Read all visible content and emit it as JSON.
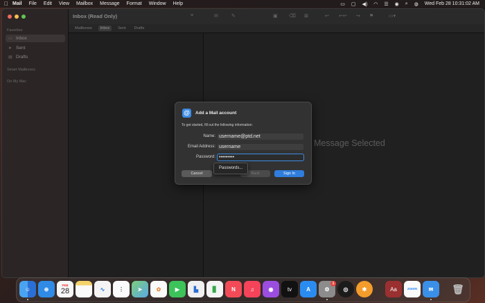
{
  "menubar": {
    "app_name": "Mail",
    "items": [
      "File",
      "Edit",
      "View",
      "Mailbox",
      "Message",
      "Format",
      "Window",
      "Help"
    ],
    "clock": "Wed Feb 28  10:31:02 AM"
  },
  "window": {
    "title": "Inbox (Read Only)",
    "favorites_bar": [
      "Mailboxes",
      "Inbox",
      "Sent",
      "Drafts"
    ],
    "selected_favorite": "Inbox",
    "no_message_text": "Message Selected"
  },
  "sidebar": {
    "favorites_header": "Favorites",
    "items": [
      {
        "label": "Inbox",
        "icon": "inbox-icon"
      },
      {
        "label": "Sent",
        "icon": "paperplane-icon"
      },
      {
        "label": "Drafts",
        "icon": "document-icon"
      }
    ],
    "smart_header": "Smart Mailboxes",
    "on_my_mac_header": "On My Mac"
  },
  "dialog": {
    "title": "Add a Mail account",
    "intro": "To get started, fill out the following information:",
    "fields": {
      "name_label": "Name:",
      "name_value": "username@ptd.net",
      "email_label": "Email Address:",
      "email_value": "username",
      "password_label": "Password:",
      "password_value": "•••••••••"
    },
    "buttons": {
      "cancel": "Cancel",
      "back": "Back",
      "sign_in": "Sign In"
    },
    "popover": "Passwords..."
  },
  "dock": {
    "calendar_month": "FEB",
    "calendar_day": "28",
    "tv_label": "tv",
    "zoom_label": "zoom",
    "dictionary_label": "Aa",
    "settings_badge": "1",
    "apps": [
      "finder-icon",
      "safari-icon",
      "calendar-icon",
      "notes-icon",
      "freeform-icon",
      "reminders-icon",
      "maps-icon",
      "photos-icon",
      "facetime-icon",
      "keynote-icon",
      "numbers-icon",
      "news-icon",
      "music-icon",
      "podcasts-icon",
      "appletv-icon",
      "appstore-icon",
      "system-settings-icon",
      "chatgpt-icon",
      "spark-icon",
      "dictionary-icon",
      "zoom-icon",
      "mail-icon",
      "trash-icon"
    ]
  }
}
